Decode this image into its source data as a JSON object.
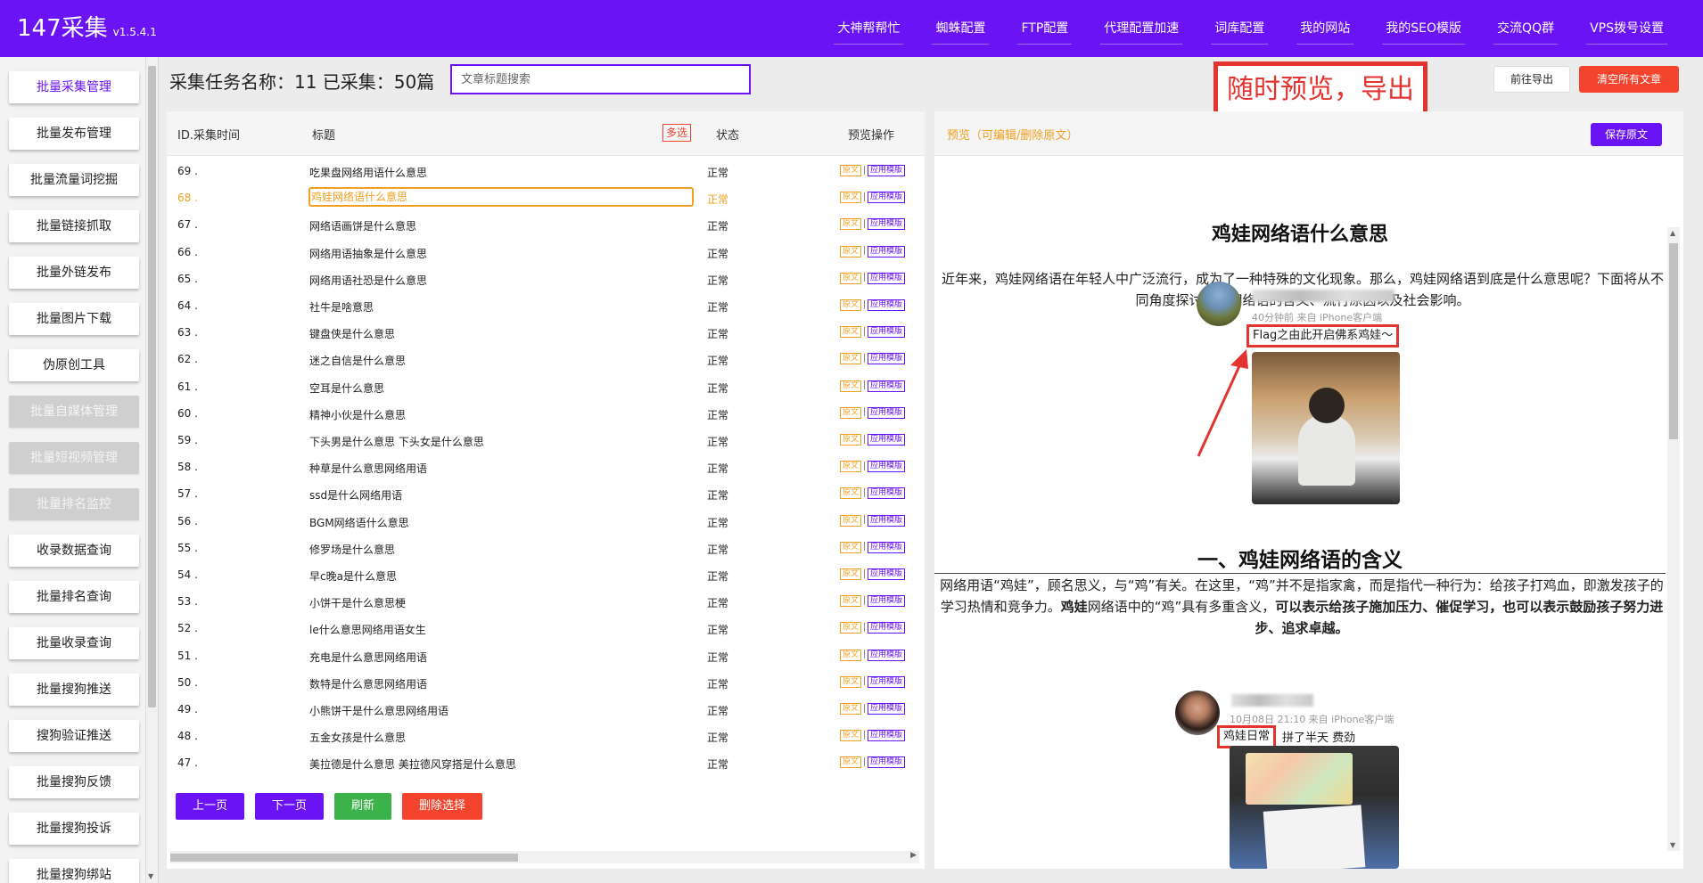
{
  "app": {
    "name": "147采集",
    "version": "v1.5.4.1"
  },
  "topnav": [
    "大神帮帮忙",
    "蜘蛛配置",
    "FTP配置",
    "代理配置加速",
    "词库配置",
    "我的网站",
    "我的SEO模版",
    "交流QQ群",
    "VPS拨号设置"
  ],
  "sidebar": [
    {
      "label": "批量采集管理",
      "state": "active"
    },
    {
      "label": "批量发布管理",
      "state": "normal"
    },
    {
      "label": "批量流量词挖掘",
      "state": "normal"
    },
    {
      "label": "批量链接抓取",
      "state": "normal"
    },
    {
      "label": "批量外链发布",
      "state": "normal"
    },
    {
      "label": "批量图片下载",
      "state": "normal"
    },
    {
      "label": "伪原创工具",
      "state": "normal"
    },
    {
      "label": "批量自媒体管理",
      "state": "disabled"
    },
    {
      "label": "批量短视频管理",
      "state": "disabled"
    },
    {
      "label": "批量排名监控",
      "state": "disabled"
    },
    {
      "label": "收录数据查询",
      "state": "normal"
    },
    {
      "label": "批量排名查询",
      "state": "normal"
    },
    {
      "label": "批量收录查询",
      "state": "normal"
    },
    {
      "label": "批量搜狗推送",
      "state": "normal"
    },
    {
      "label": "搜狗验证推送",
      "state": "normal"
    },
    {
      "label": "批量搜狗反馈",
      "state": "normal"
    },
    {
      "label": "批量搜狗投诉",
      "state": "normal"
    },
    {
      "label": "批量搜狗绑站",
      "state": "normal"
    }
  ],
  "task": {
    "title": "采集任务名称：11 已采集：50篇"
  },
  "search": {
    "placeholder": "文章标题搜索"
  },
  "callout": {
    "text": "随时预览，导出"
  },
  "actions": {
    "export": "前往导出",
    "clear": "清空所有文章"
  },
  "table": {
    "headers": {
      "id_time": "ID.采集时间",
      "title": "标题",
      "multi": "多选",
      "status": "状态",
      "ops": "预览操作"
    },
    "action_labels": {
      "original": "原文",
      "apply": "应用模版"
    },
    "selected_id": "68",
    "rows": [
      {
        "id": "69 .",
        "title": "吃果盘网络用语什么意思",
        "status": "正常"
      },
      {
        "id": "68 .",
        "title": "鸡娃网络语什么意思",
        "status": "正常"
      },
      {
        "id": "67 .",
        "title": "网络语画饼是什么意思",
        "status": "正常"
      },
      {
        "id": "66 .",
        "title": "网络用语抽象是什么意思",
        "status": "正常"
      },
      {
        "id": "65 .",
        "title": "网络用语社恐是什么意思",
        "status": "正常"
      },
      {
        "id": "64 .",
        "title": "社牛是啥意思",
        "status": "正常"
      },
      {
        "id": "63 .",
        "title": "键盘侠是什么意思",
        "status": "正常"
      },
      {
        "id": "62 .",
        "title": "迷之自信是什么意思",
        "status": "正常"
      },
      {
        "id": "61 .",
        "title": "空耳是什么意思",
        "status": "正常"
      },
      {
        "id": "60 .",
        "title": "精神小伙是什么意思",
        "status": "正常"
      },
      {
        "id": "59 .",
        "title": "下头男是什么意思 下头女是什么意思",
        "status": "正常"
      },
      {
        "id": "58 .",
        "title": "种草是什么意思网络用语",
        "status": "正常"
      },
      {
        "id": "57 .",
        "title": "ssd是什么网络用语",
        "status": "正常"
      },
      {
        "id": "56 .",
        "title": "BGM网络语什么意思",
        "status": "正常"
      },
      {
        "id": "55 .",
        "title": "修罗场是什么意思",
        "status": "正常"
      },
      {
        "id": "54 .",
        "title": "早c晚a是什么意思",
        "status": "正常"
      },
      {
        "id": "53 .",
        "title": "小饼干是什么意思梗",
        "status": "正常"
      },
      {
        "id": "52 .",
        "title": "le什么意思网络用语女生",
        "status": "正常"
      },
      {
        "id": "51 .",
        "title": "充电是什么意思网络用语",
        "status": "正常"
      },
      {
        "id": "50 .",
        "title": "数特是什么意思网络用语",
        "status": "正常"
      },
      {
        "id": "49 .",
        "title": "小熊饼干是什么意思网络用语",
        "status": "正常"
      },
      {
        "id": "48 .",
        "title": "五金女孩是什么意思",
        "status": "正常"
      },
      {
        "id": "47 .",
        "title": "美拉德是什么意思 美拉德风穿搭是什么意思",
        "status": "正常"
      }
    ]
  },
  "pager": {
    "prev": "上一页",
    "next": "下一页",
    "refresh": "刷新",
    "delete": "删除选择"
  },
  "preview": {
    "label": "预览（可编辑/删除原文）",
    "save": "保存原文",
    "article_title": "鸡娃网络语什么意思",
    "intro": "近年来，鸡娃网络语在年轻人中广泛流行，成为了一种特殊的文化现象。那么，鸡娃网络语到底是什么意思呢？下面将从不同角度探讨鸡娃网络语的含义、流行原因以及社会影响。",
    "post1": {
      "meta": "40分钟前 来自 iPhone客户端",
      "text": "Flag之由此开启佛系鸡娃～"
    },
    "section1_title": "一、鸡娃网络语的含义",
    "section1_part1": "网络用语“鸡娃”，顾名思义，与“鸡”有关。在这里，“鸡”并不是指家禽，而是指代一种行为：给孩子打鸡血，即激发孩子的学习热情和竞争力。",
    "section1_bold1": "鸡娃",
    "section1_part2": "网络语中的“鸡”具有多重含义，",
    "section1_bold2": "可以表示给孩子施加压力、催促学习，也可以表示鼓励孩子努力进步、追求卓越。",
    "post2": {
      "meta": "10月08日 21:10 来自 iPhone客户端",
      "tag": "鸡娃日常",
      "text": "拼了半天 费劲"
    }
  },
  "colors": {
    "brand": "#6a14f5",
    "danger": "#f4442e",
    "warning": "#f0a020",
    "success": "#3cb34a",
    "annotation": "#e3342f"
  }
}
